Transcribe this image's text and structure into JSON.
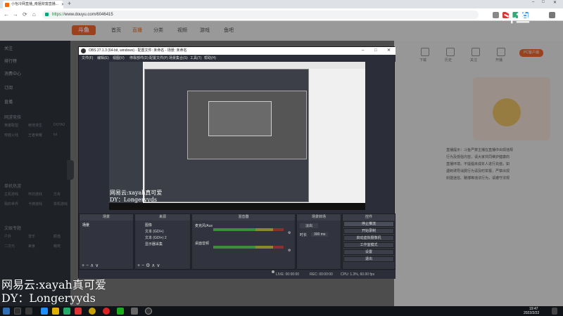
{
  "browser": {
    "tab_title": "小怡冷网直播_南姐财富直播...",
    "url_protocol": "https://",
    "url_rest": "www.douyu.com/6046415",
    "controls": {
      "minimize": "–",
      "maximize": "□",
      "close": "✕",
      "back": "←",
      "forward": "→",
      "reload": "⟳",
      "home": "⌂",
      "new_tab": "+"
    }
  },
  "site": {
    "logo": "斗鱼",
    "nav": [
      "首页",
      "直播",
      "分类",
      "视频",
      "游戏",
      "鱼吧"
    ],
    "sidebar_top": [
      "关注",
      "排行榜",
      "消费中心",
      "订阅",
      "直播"
    ],
    "sidebar_sections": [
      {
        "head": "网游竞技",
        "items": [
          "英雄联盟",
          "绝地求生",
          "DOTA2",
          "穿越火线",
          "王者荣耀",
          "lol"
        ]
      },
      {
        "head": "单机热游",
        "items": [
          "主机游戏",
          "怀旧游戏",
          "方舟",
          "我的世界",
          "卡牌游戏",
          "单机游戏"
        ]
      },
      {
        "head": "文娱专题",
        "items": [
          "户外",
          "音乐",
          "颜值",
          "二次元",
          "美食",
          "萌宠"
        ]
      }
    ],
    "right_icons": [
      "下载",
      "历史",
      "关注",
      "开播"
    ],
    "pc_button": "PC客户端",
    "notice_lines": [
      "直播提示：斗鱼严禁主播在直播中出现违规",
      "行为及低俗内容，请大家共同维护健康的",
      "直播环境。不提倡未成年人进行充值，如",
      "遇到诱导消费行为请及时举报，严禁出现",
      "封建迷信、赌博等违法行为，请遵守法规"
    ]
  },
  "obs": {
    "title": "OBS 27.1.3 (64-bit, windows) - 配置文件: 未命名 - 场景: 未命名",
    "menu": [
      "文件(F)",
      "编辑(E)",
      "视图(V)",
      "停靠部件(D)",
      "配置文件(P)",
      "场景集合(S)",
      "工具(T)",
      "帮助(H)"
    ],
    "docks": {
      "scenes": "场景",
      "sources": "来源",
      "mixer": "混音器",
      "transitions": "场景转场",
      "controls": "控件"
    },
    "scene_item": "场景",
    "sources_list": [
      "图像",
      "文本 (GDI+)",
      "文本 (GDI+) 2",
      "显示器采集"
    ],
    "mixer_tracks": [
      "桌面音频",
      "麦克风/Aux"
    ],
    "transition_value": "淡出",
    "duration_label": "时长",
    "duration_value": "300 ms",
    "buttons": [
      "停止推流",
      "开始录制",
      "启动虚拟摄像机",
      "工作室模式",
      "设置",
      "退出"
    ],
    "status": {
      "live": "LIVE: 00:00:00",
      "rec": "REC: 00:00:00",
      "cpu": "CPU: 1.3%, 60.00 fps"
    }
  },
  "overlay": {
    "line1": "网易云:xayah真可爱",
    "line2": "DY：Longeryyds"
  },
  "watermark": "斗鱼",
  "taskbar": {
    "time": "19:47",
    "date": "2022/2/22"
  }
}
